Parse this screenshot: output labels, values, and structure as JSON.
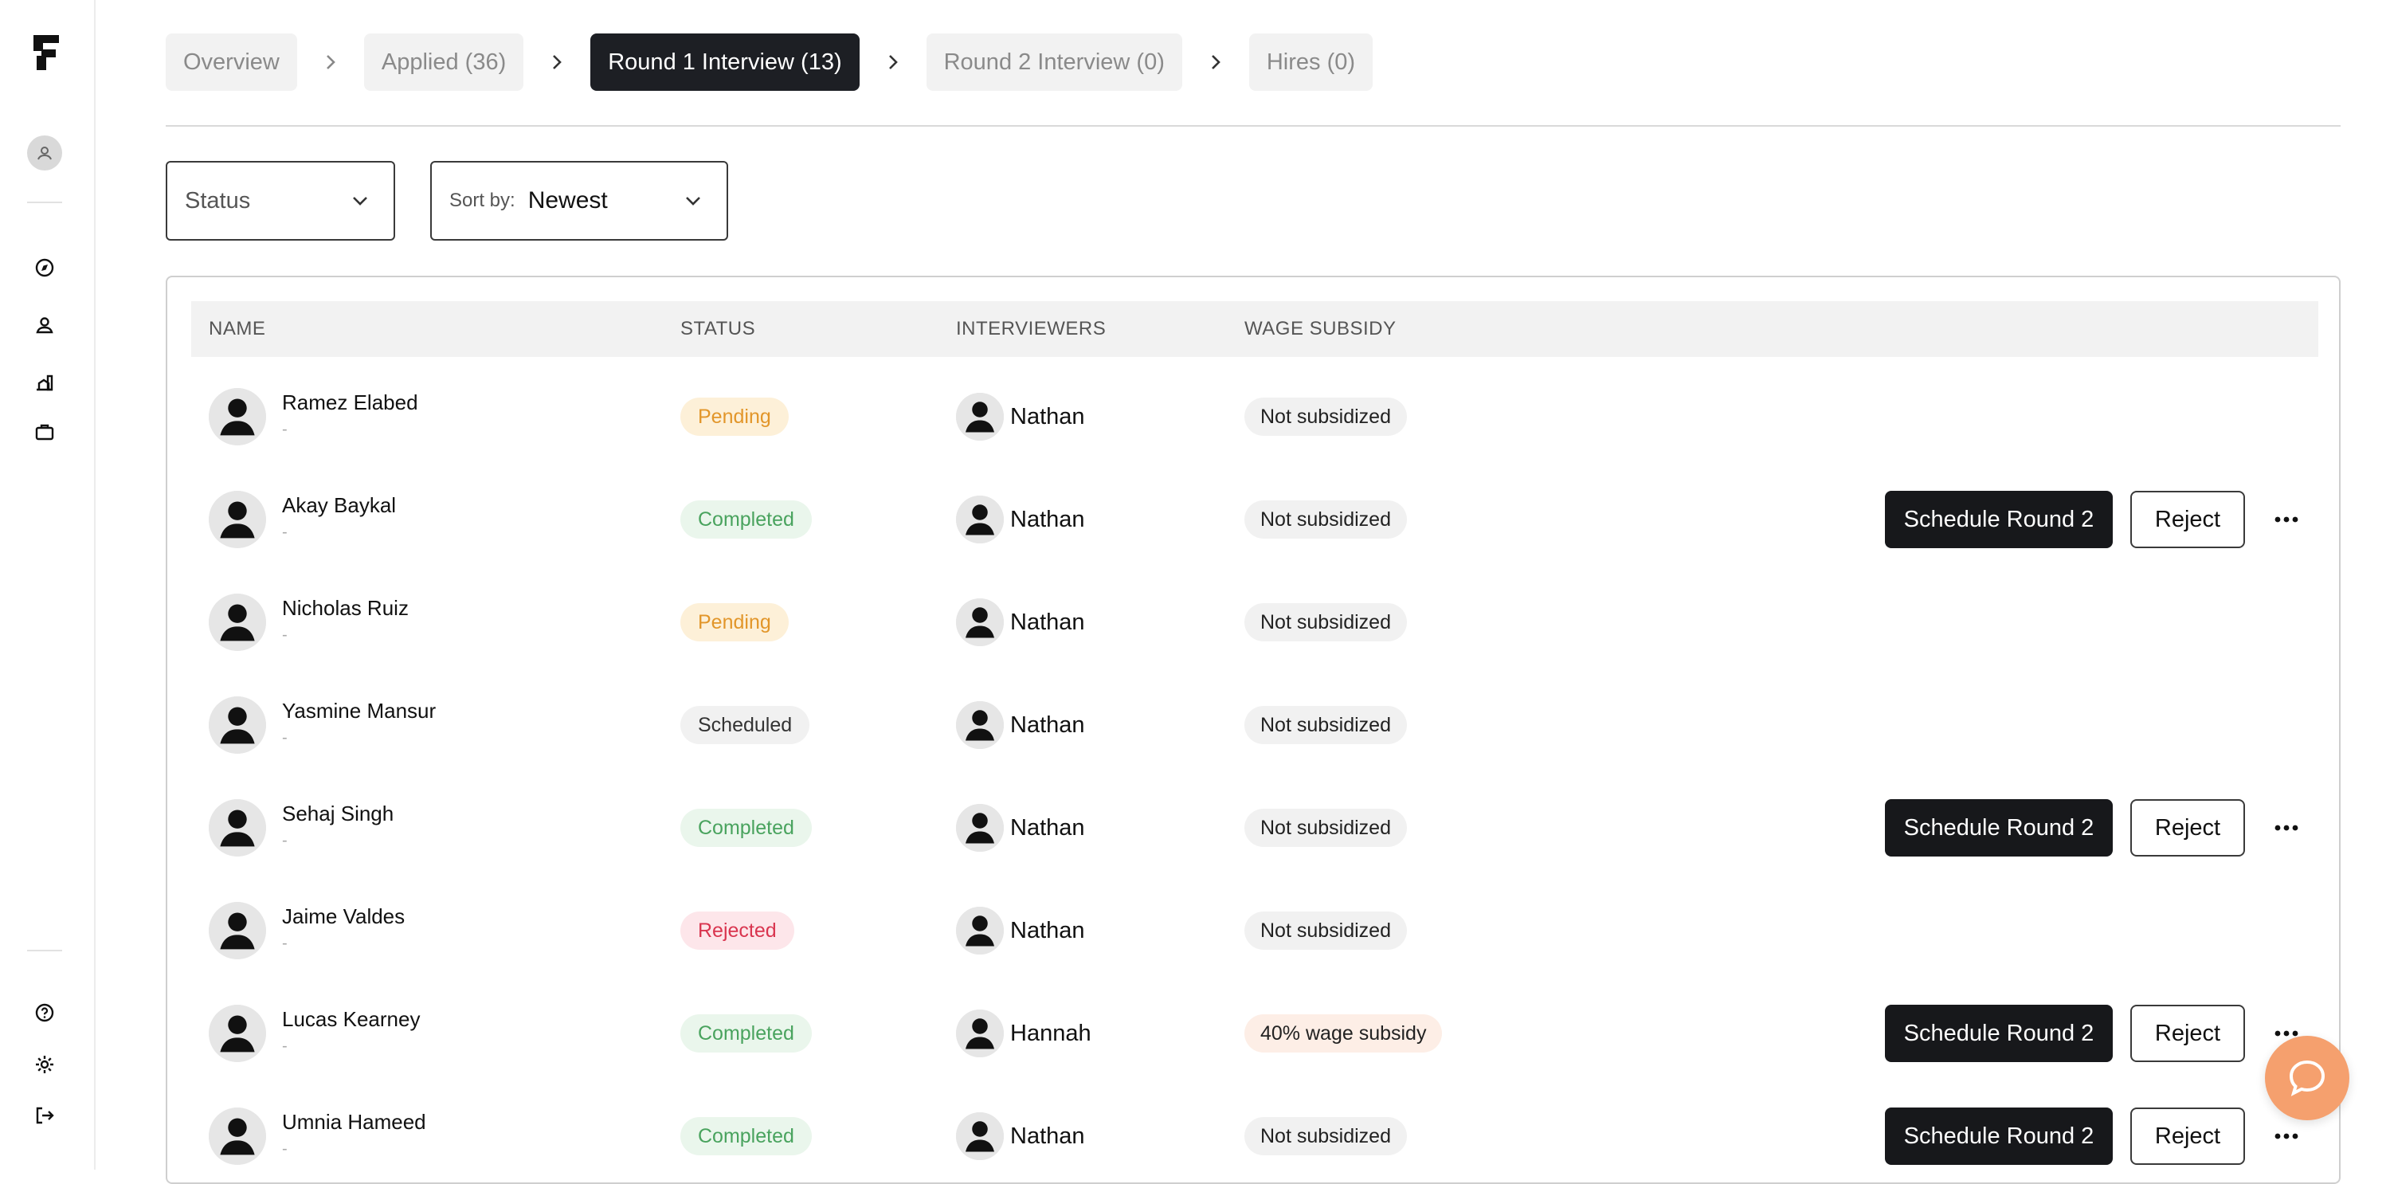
{
  "sidebar": {
    "icons": [
      "logo-icon",
      "profile-icon",
      "explore-icon",
      "candidates-icon",
      "analytics-icon",
      "jobs-icon",
      "help-icon",
      "settings-icon",
      "logout-icon"
    ]
  },
  "stages": [
    {
      "label": "Overview"
    },
    {
      "label": "Applied (36)"
    },
    {
      "label": "Round 1 Interview (13)"
    },
    {
      "label": "Round 2 Interview (0)"
    },
    {
      "label": "Hires (0)"
    }
  ],
  "filters": {
    "status_label": "Status",
    "sort_prefix": "Sort by:",
    "sort_value": "Newest"
  },
  "table": {
    "headers": {
      "name": "NAME",
      "status": "STATUS",
      "interviewers": "INTERVIEWERS",
      "wage": "WAGE SUBSIDY"
    },
    "rows": [
      {
        "name": "Ramez Elabed",
        "sub": "-",
        "status": "Pending",
        "interviewer": "Nathan",
        "wage": "Not subsidized",
        "actions": false
      },
      {
        "name": "Akay Baykal",
        "sub": "-",
        "status": "Completed",
        "interviewer": "Nathan",
        "wage": "Not subsidized",
        "actions": true
      },
      {
        "name": "Nicholas Ruiz",
        "sub": "-",
        "status": "Pending",
        "interviewer": "Nathan",
        "wage": "Not subsidized",
        "actions": false
      },
      {
        "name": "Yasmine Mansur",
        "sub": "-",
        "status": "Scheduled",
        "interviewer": "Nathan",
        "wage": "Not subsidized",
        "actions": false
      },
      {
        "name": "Sehaj Singh",
        "sub": "-",
        "status": "Completed",
        "interviewer": "Nathan",
        "wage": "Not subsidized",
        "actions": true
      },
      {
        "name": "Jaime Valdes",
        "sub": "-",
        "status": "Rejected",
        "interviewer": "Nathan",
        "wage": "Not subsidized",
        "actions": false
      },
      {
        "name": "Lucas Kearney",
        "sub": "-",
        "status": "Completed",
        "interviewer": "Hannah",
        "wage": "40% wage subsidy",
        "actions": true
      },
      {
        "name": "Umnia Hameed",
        "sub": "-",
        "status": "Completed",
        "interviewer": "Nathan",
        "wage": "Not subsidized",
        "actions": true
      }
    ],
    "action_labels": {
      "schedule": "Schedule Round 2",
      "reject": "Reject"
    }
  },
  "colors": {
    "primary": "#17181b",
    "pending": "#e2962a",
    "completed": "#49a35e",
    "rejected": "#d9354f",
    "help_fab": "#f5a06e"
  }
}
